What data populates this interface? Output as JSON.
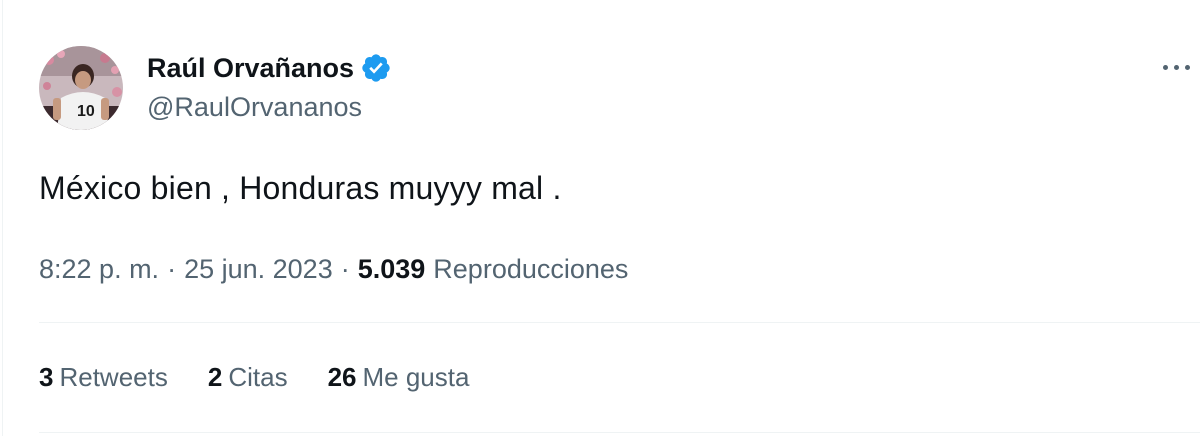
{
  "tweet": {
    "author": {
      "display_name": "Raúl Orvañanos",
      "handle": "@RaulOrvananos",
      "verified": true,
      "avatar_jersey_number": "10"
    },
    "text": "México bien , Honduras muyyy mal .",
    "meta": {
      "time": "8:22 p. m.",
      "separator": "·",
      "date": "25 jun. 2023",
      "views_count": "5.039",
      "views_label": "Reproducciones"
    },
    "stats": [
      {
        "count": "3",
        "label": "Retweets"
      },
      {
        "count": "2",
        "label": "Citas"
      },
      {
        "count": "26",
        "label": "Me gusta"
      }
    ],
    "more_icon": "more-horizontal-icon"
  },
  "colors": {
    "primary_text": "#0f1419",
    "secondary_text": "#536471",
    "verified_blue": "#1d9bf0",
    "divider": "#eff3f4"
  }
}
